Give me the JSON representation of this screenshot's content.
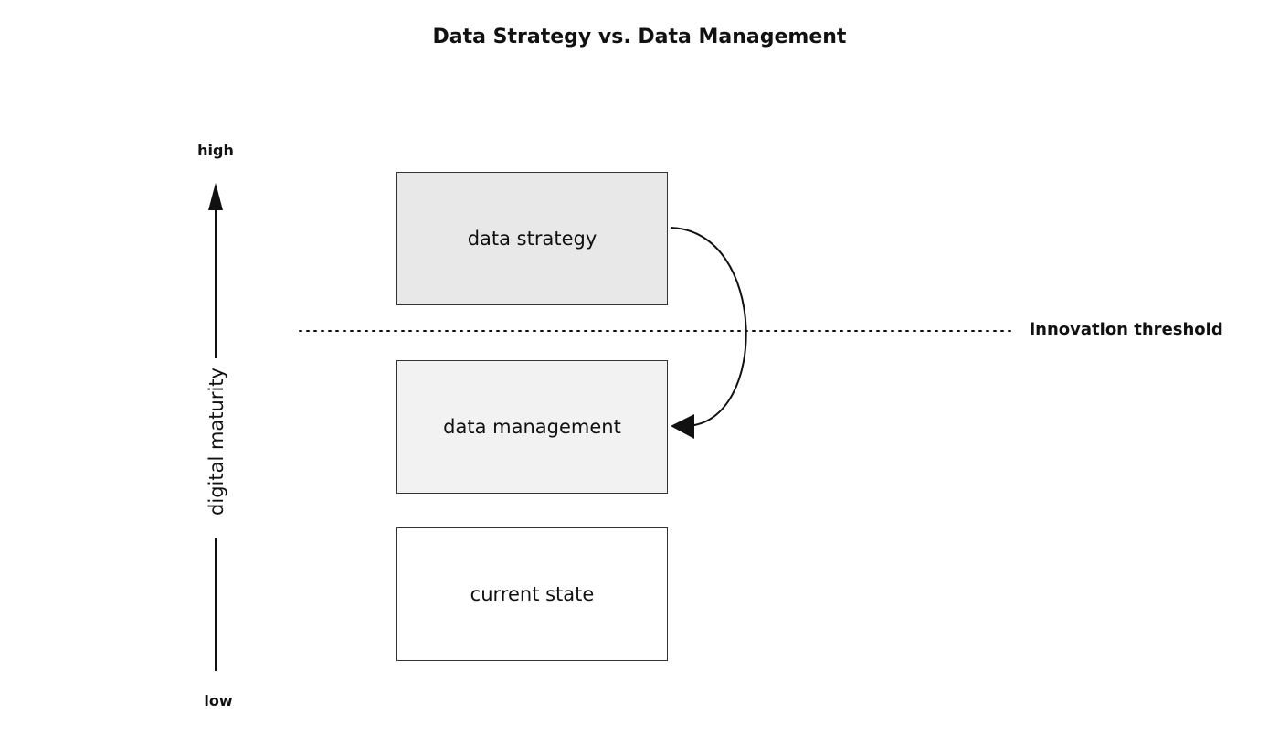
{
  "title": "Data Strategy vs. Data Management",
  "axis": {
    "high_label": "high",
    "low_label": "low",
    "title": "digital maturity"
  },
  "boxes": {
    "strategy": "data strategy",
    "management": "data management",
    "current": "current state"
  },
  "threshold": {
    "label": "innovation threshold"
  },
  "colors": {
    "strategy_fill": "#e8e8e8",
    "management_fill": "#f2f2f2",
    "current_fill": "#ffffff",
    "line": "#111111"
  }
}
